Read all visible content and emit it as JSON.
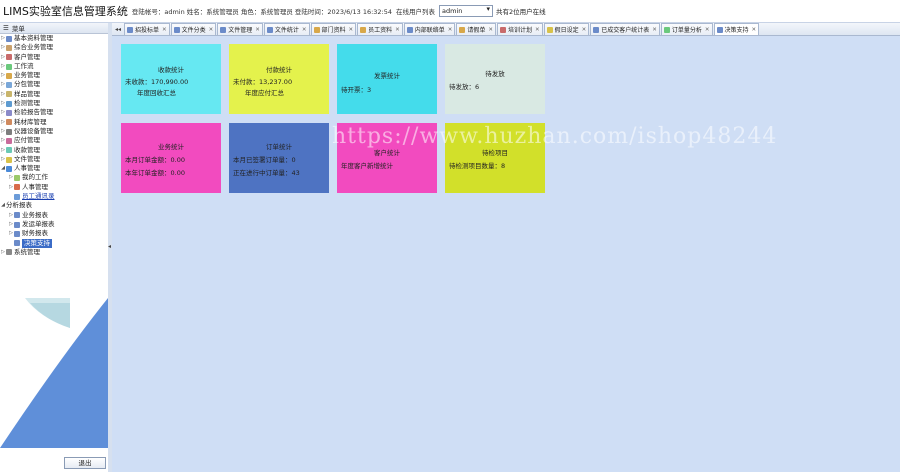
{
  "header": {
    "title": "LIMS实验室信息管理系统",
    "info": "登陆帐号：admin  姓名：系统管理员  角色：系统管理员  登陆时间：2023/6/13 16:32:54",
    "online_label": "在线用户列表",
    "online_user": "admin",
    "online_count": "共有2位用户在线"
  },
  "sidebar": {
    "heading": "菜单",
    "logout": "退出",
    "items": [
      {
        "label": "基本资料管理",
        "color": "#6b8bc9"
      },
      {
        "label": "综合业务管理",
        "color": "#c9a06b"
      },
      {
        "label": "客户管理",
        "color": "#c96b6b"
      },
      {
        "label": "工作流",
        "color": "#6bc97d"
      },
      {
        "label": "业务管理",
        "color": "#d8a84a"
      },
      {
        "label": "分包管理",
        "color": "#7aa7d8"
      },
      {
        "label": "样品管理",
        "color": "#c9b56b"
      },
      {
        "label": "检测管理",
        "color": "#5e9bd0"
      },
      {
        "label": "检验报告管理",
        "color": "#8a8ac9"
      },
      {
        "label": "耗材库管理",
        "color": "#d08a5e"
      },
      {
        "label": "仪器设备管理",
        "color": "#7d7d7d"
      },
      {
        "label": "应付管理",
        "color": "#c96b9b"
      },
      {
        "label": "收款管理",
        "color": "#6bc9b5"
      },
      {
        "label": "文件管理",
        "color": "#d8c24a"
      },
      {
        "label": "人事管理",
        "color": "#4a8ad8"
      },
      {
        "label": "我的工作",
        "color": "#9bc96b"
      },
      {
        "label": "人事管理",
        "color": "#d86b4a"
      },
      {
        "label": "员工通讯录",
        "color": "#6b9bd8"
      },
      {
        "label": "分析报表",
        "color": ""
      },
      {
        "label": "业务报表",
        "color": "#6b8bc9"
      },
      {
        "label": "发运单报表",
        "color": "#6b8bc9"
      },
      {
        "label": "财务报表",
        "color": "#6b8bc9"
      },
      {
        "label": "决策支持",
        "color": "#6b8bc9"
      },
      {
        "label": "系统管理",
        "color": "#888888"
      }
    ]
  },
  "tabs": [
    {
      "label": "招投标单",
      "color": "#6b8bc9"
    },
    {
      "label": "文件分类",
      "color": "#6b8bc9"
    },
    {
      "label": "文件管理",
      "color": "#6b8bc9"
    },
    {
      "label": "文件统计",
      "color": "#6b8bc9"
    },
    {
      "label": "部门资料",
      "color": "#d8a84a"
    },
    {
      "label": "员工资料",
      "color": "#d8a84a"
    },
    {
      "label": "内部联络单",
      "color": "#6b8bc9"
    },
    {
      "label": "请假单",
      "color": "#d8a84a"
    },
    {
      "label": "培训计划",
      "color": "#c96b6b"
    },
    {
      "label": "假日设定",
      "color": "#d8c24a"
    },
    {
      "label": "已成交客户统计表",
      "color": "#6b8bc9"
    },
    {
      "label": "订单量分析",
      "color": "#6bc97d"
    },
    {
      "label": "决策支持",
      "color": "#6b8bc9"
    }
  ],
  "cards": [
    {
      "title": "收款统计",
      "lines": [
        "未收款：170,990.00",
        "年度回收汇总"
      ],
      "color": "#66e8f2"
    },
    {
      "title": "付款统计",
      "lines": [
        "未付款：13,237.00",
        "年度应付汇总"
      ],
      "color": "#e4f24c"
    },
    {
      "title": "发票统计",
      "lines": [
        "待开票：3"
      ],
      "color": "#44dceb"
    },
    {
      "title": "待发放",
      "lines": [
        "待发放：6"
      ],
      "color": "#d9e9e3"
    },
    {
      "title": "业务统计",
      "lines": [
        "本月订单金额：0.00",
        "本年订单金额：0.00"
      ],
      "color": "#f24bbf"
    },
    {
      "title": "订单统计",
      "lines": [
        "本月已签署订单量：0",
        "正在进行中订单量：43"
      ],
      "color": "#4e73c2"
    },
    {
      "title": "客户统计",
      "lines": [
        "年度客户新增统计"
      ],
      "color": "#f24bbf"
    },
    {
      "title": "待检项目",
      "lines": [
        "待检测项目数量：8"
      ],
      "color": "#d2e02a"
    }
  ],
  "watermark": "https://www.huzhan.com/ishop48244"
}
